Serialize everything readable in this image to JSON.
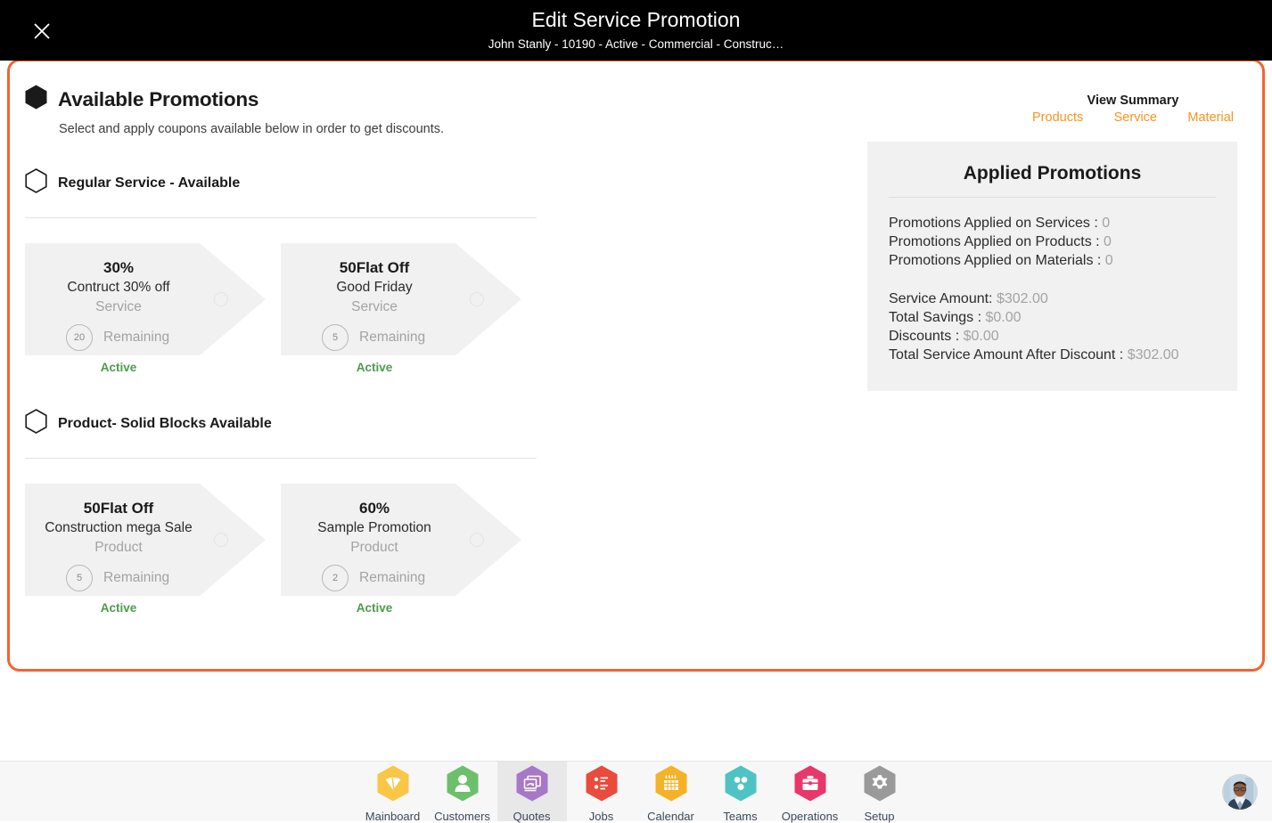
{
  "header": {
    "title": "Edit Service Promotion",
    "subtitle": "John Stanly - 10190 - Active - Commercial - Construc…",
    "close_icon": "close-icon"
  },
  "page": {
    "title": "Available Promotions",
    "subtitle": "Select and apply coupons available below in order to get discounts."
  },
  "view_summary": {
    "label": "View Summary",
    "links": [
      {
        "label": "Products",
        "color": "#f7941e"
      },
      {
        "label": "Service",
        "color": "#f7941e"
      },
      {
        "label": "Material",
        "color": "#f7941e"
      }
    ]
  },
  "sections": [
    {
      "title": "Regular Service - Available",
      "coupons": [
        {
          "amount": "30%",
          "name": "Contruct 30% off",
          "type": "Service",
          "remaining_count": "20",
          "remaining_label": "Remaining",
          "status": "Active"
        },
        {
          "amount": "50Flat Off",
          "name": "Good Friday",
          "type": "Service",
          "remaining_count": "5",
          "remaining_label": "Remaining",
          "status": "Active"
        }
      ]
    },
    {
      "title": "Product- Solid Blocks Available",
      "coupons": [
        {
          "amount": "50Flat Off",
          "name": "Construction mega Sale",
          "type": "Product",
          "remaining_count": "5",
          "remaining_label": "Remaining",
          "status": "Active"
        },
        {
          "amount": "60%",
          "name": "Sample Promotion",
          "type": "Product",
          "remaining_count": "2",
          "remaining_label": "Remaining",
          "status": "Active"
        }
      ]
    }
  ],
  "applied_promotions": {
    "title": "Applied Promotions",
    "counts": [
      {
        "label": "Promotions Applied on Services : ",
        "value": "0"
      },
      {
        "label": "Promotions Applied on Products : ",
        "value": "0"
      },
      {
        "label": "Promotions Applied on Materials : ",
        "value": "0"
      }
    ],
    "amounts": [
      {
        "label": "Service Amount: ",
        "value": "$302.00"
      },
      {
        "label": "Total Savings : ",
        "value": "$0.00"
      },
      {
        "label": "Discounts : ",
        "value": "$0.00"
      },
      {
        "label": "Total Service Amount After Discount : ",
        "value": "$302.00"
      }
    ]
  },
  "footer_nav": {
    "items": [
      {
        "label": "Mainboard",
        "icon": "dashboard-icon",
        "color": "#f9c646",
        "active": false
      },
      {
        "label": "Customers",
        "icon": "person-icon",
        "color": "#6cc06c",
        "active": false
      },
      {
        "label": "Quotes",
        "icon": "documents-icon",
        "color": "#a777c8",
        "active": true
      },
      {
        "label": "Jobs",
        "icon": "list-icon",
        "color": "#e94b3c",
        "active": false
      },
      {
        "label": "Calendar",
        "icon": "calendar-icon",
        "color": "#f5b227",
        "active": false
      },
      {
        "label": "Teams",
        "icon": "team-icon",
        "color": "#4fc3c3",
        "active": false
      },
      {
        "label": "Operations",
        "icon": "briefcase-icon",
        "color": "#e8376a",
        "active": false
      },
      {
        "label": "Setup",
        "icon": "gear-icon",
        "color": "#9a9a9a",
        "active": false
      }
    ]
  },
  "theme": {
    "panel_border": "#f26430",
    "accent_orange": "#f7941e",
    "active_green": "#4d9a4d",
    "card_bg": "#f1f1f1"
  }
}
